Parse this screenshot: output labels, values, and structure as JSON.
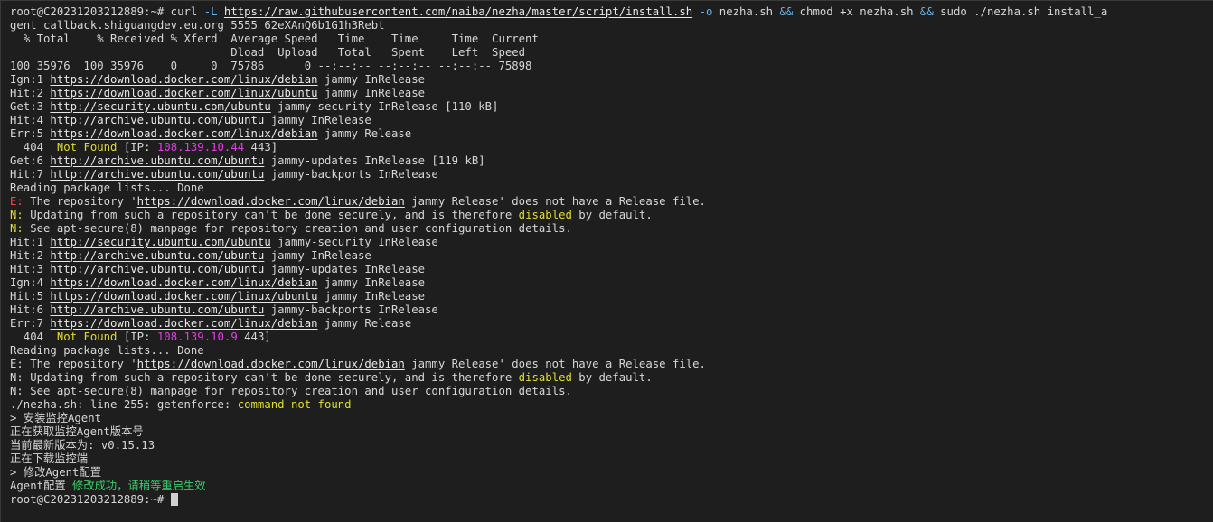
{
  "terminal": {
    "cursor_visible": true,
    "colors": {
      "background": "#1e1e1e",
      "text": "#d6d6d6",
      "option": "#6ab3e6",
      "warning": "#e0dc2e",
      "ip": "#e23ee6",
      "error_prefix": "#f04a4a",
      "success": "#3ccc6c"
    },
    "lines": [
      [
        {
          "t": "root@C20231203212889:~# curl ",
          "c": ""
        },
        {
          "t": "-L",
          "c": "opt"
        },
        {
          "t": " ",
          "c": ""
        },
        {
          "t": "https://raw.githubusercontent.com/naiba/nezha/master/script/install.sh",
          "c": "url"
        },
        {
          "t": " ",
          "c": ""
        },
        {
          "t": "-o",
          "c": "opt"
        },
        {
          "t": " nezha.sh ",
          "c": ""
        },
        {
          "t": "&&",
          "c": "op"
        },
        {
          "t": " chmod +x nezha.sh ",
          "c": ""
        },
        {
          "t": "&&",
          "c": "op"
        },
        {
          "t": " sudo ./nezha.sh install_a",
          "c": ""
        }
      ],
      [
        {
          "t": "gent callback.shiguangdev.eu.org 5555 62eXAnQ6b1G1h3Rebt",
          "c": ""
        }
      ],
      [
        {
          "t": "  % Total    % Received % Xferd  Average Speed   Time    Time     Time  Current",
          "c": ""
        }
      ],
      [
        {
          "t": "                                 Dload  Upload   Total   Spent    Left  Speed",
          "c": ""
        }
      ],
      [
        {
          "t": "100 35976  100 35976    0     0  75786      0 --:--:-- --:--:-- --:--:-- 75898",
          "c": ""
        }
      ],
      [
        {
          "t": "Ign:1 ",
          "c": ""
        },
        {
          "t": "https://download.docker.com/linux/debian",
          "c": "url"
        },
        {
          "t": " jammy InRelease",
          "c": ""
        }
      ],
      [
        {
          "t": "Hit:2 ",
          "c": ""
        },
        {
          "t": "https://download.docker.com/linux/ubuntu",
          "c": "url"
        },
        {
          "t": " jammy InRelease",
          "c": ""
        }
      ],
      [
        {
          "t": "Get:3 ",
          "c": ""
        },
        {
          "t": "http://security.ubuntu.com/ubuntu",
          "c": "url"
        },
        {
          "t": " jammy-security InRelease [110 kB]",
          "c": ""
        }
      ],
      [
        {
          "t": "Hit:4 ",
          "c": ""
        },
        {
          "t": "http://archive.ubuntu.com/ubuntu",
          "c": "url"
        },
        {
          "t": " jammy InRelease",
          "c": ""
        }
      ],
      [
        {
          "t": "Err:5 ",
          "c": ""
        },
        {
          "t": "https://download.docker.com/linux/debian",
          "c": "url"
        },
        {
          "t": " jammy Release",
          "c": ""
        }
      ],
      [
        {
          "t": "  404  ",
          "c": ""
        },
        {
          "t": "Not Found",
          "c": "yellow"
        },
        {
          "t": " [IP: ",
          "c": ""
        },
        {
          "t": "108.139.10.44",
          "c": "magenta"
        },
        {
          "t": " 443]",
          "c": ""
        }
      ],
      [
        {
          "t": "Get:6 ",
          "c": ""
        },
        {
          "t": "http://archive.ubuntu.com/ubuntu",
          "c": "url"
        },
        {
          "t": " jammy-updates InRelease [119 kB]",
          "c": ""
        }
      ],
      [
        {
          "t": "Hit:7 ",
          "c": ""
        },
        {
          "t": "http://archive.ubuntu.com/ubuntu",
          "c": "url"
        },
        {
          "t": " jammy-backports InRelease",
          "c": ""
        }
      ],
      [
        {
          "t": "Reading package lists... Done",
          "c": ""
        }
      ],
      [
        {
          "t": "E:",
          "c": "red"
        },
        {
          "t": " The repository '",
          "c": ""
        },
        {
          "t": "https://download.docker.com/linux/debian",
          "c": "url"
        },
        {
          "t": " jammy Release' does not have a Release file.",
          "c": ""
        }
      ],
      [
        {
          "t": "N:",
          "c": "yellow"
        },
        {
          "t": " Updating from such a repository can't be done securely, and is therefore ",
          "c": ""
        },
        {
          "t": "disabled",
          "c": "yellow"
        },
        {
          "t": " by default.",
          "c": ""
        }
      ],
      [
        {
          "t": "N:",
          "c": "yellow"
        },
        {
          "t": " See apt-secure(8) manpage for repository creation and user configuration details.",
          "c": ""
        }
      ],
      [
        {
          "t": "Hit:1 ",
          "c": ""
        },
        {
          "t": "http://security.ubuntu.com/ubuntu",
          "c": "url"
        },
        {
          "t": " jammy-security InRelease",
          "c": ""
        }
      ],
      [
        {
          "t": "Hit:2 ",
          "c": ""
        },
        {
          "t": "http://archive.ubuntu.com/ubuntu",
          "c": "url"
        },
        {
          "t": " jammy InRelease",
          "c": ""
        }
      ],
      [
        {
          "t": "Hit:3 ",
          "c": ""
        },
        {
          "t": "http://archive.ubuntu.com/ubuntu",
          "c": "url"
        },
        {
          "t": " jammy-updates InRelease",
          "c": ""
        }
      ],
      [
        {
          "t": "Ign:4 ",
          "c": ""
        },
        {
          "t": "https://download.docker.com/linux/debian",
          "c": "url"
        },
        {
          "t": " jammy InRelease",
          "c": ""
        }
      ],
      [
        {
          "t": "Hit:5 ",
          "c": ""
        },
        {
          "t": "https://download.docker.com/linux/ubuntu",
          "c": "url"
        },
        {
          "t": " jammy InRelease",
          "c": ""
        }
      ],
      [
        {
          "t": "Hit:6 ",
          "c": ""
        },
        {
          "t": "http://archive.ubuntu.com/ubuntu",
          "c": "url"
        },
        {
          "t": " jammy-backports InRelease",
          "c": ""
        }
      ],
      [
        {
          "t": "Err:7 ",
          "c": ""
        },
        {
          "t": "https://download.docker.com/linux/debian",
          "c": "url"
        },
        {
          "t": " jammy Release",
          "c": ""
        }
      ],
      [
        {
          "t": "  404  ",
          "c": ""
        },
        {
          "t": "Not Found",
          "c": "yellow"
        },
        {
          "t": " [IP: ",
          "c": ""
        },
        {
          "t": "108.139.10.9",
          "c": "magenta"
        },
        {
          "t": " 443]",
          "c": ""
        }
      ],
      [
        {
          "t": "Reading package lists... Done",
          "c": ""
        }
      ],
      [
        {
          "t": "E: The repository '",
          "c": ""
        },
        {
          "t": "https://download.docker.com/linux/debian",
          "c": "url"
        },
        {
          "t": " jammy Release' does not have a Release file.",
          "c": ""
        }
      ],
      [
        {
          "t": "N: Updating from such a repository can't be done securely, and is therefore ",
          "c": ""
        },
        {
          "t": "disabled",
          "c": "yellow"
        },
        {
          "t": " by default.",
          "c": ""
        }
      ],
      [
        {
          "t": "N: See apt-secure(8) manpage for repository creation and user configuration details.",
          "c": ""
        }
      ],
      [
        {
          "t": "./nezha.sh: line 255: getenforce: ",
          "c": ""
        },
        {
          "t": "command not found",
          "c": "yellow"
        }
      ],
      [
        {
          "t": "> 安装监控Agent",
          "c": ""
        }
      ],
      [
        {
          "t": "正在获取监控Agent版本号",
          "c": ""
        }
      ],
      [
        {
          "t": "当前最新版本为: v0.15.13",
          "c": ""
        }
      ],
      [
        {
          "t": "正在下载监控端",
          "c": ""
        }
      ],
      [
        {
          "t": "> 修改Agent配置",
          "c": ""
        }
      ],
      [
        {
          "t": "Agent配置 ",
          "c": ""
        },
        {
          "t": "修改成功，请稍等重启生效",
          "c": "green"
        }
      ],
      [
        {
          "t": "root@C20231203212889:~# ",
          "c": ""
        }
      ]
    ]
  }
}
